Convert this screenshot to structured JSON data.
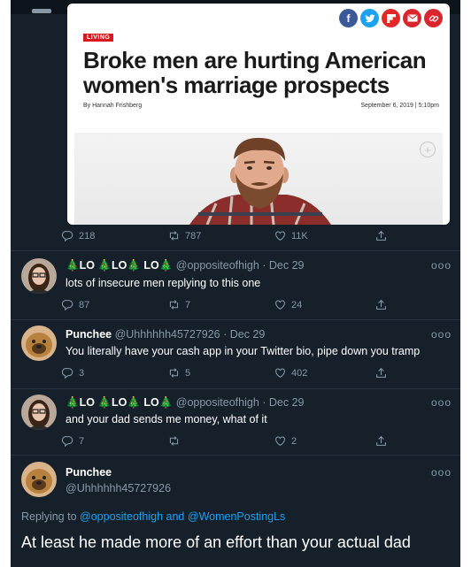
{
  "article": {
    "section": "LIVING",
    "headline": "Broke men are hurting American women's marriage prospects",
    "byline": "By Hannah Frishberg",
    "date": "September 6, 2019 | 5:10pm",
    "share_icons": [
      "facebook-icon",
      "twitter-icon",
      "flipboard-icon",
      "email-icon",
      "link-icon"
    ]
  },
  "main_tweet_stats": {
    "replies": "218",
    "retweets": "787",
    "likes": "11K"
  },
  "tweets": [
    {
      "name": "🎄LO 🎄LO🎄 LO🎄",
      "handle": "@oppositeofhigh",
      "date": "· Dec 29",
      "text": "lots of insecure men replying to this one",
      "replies": "87",
      "retweets": "7",
      "likes": "24"
    },
    {
      "name": "Punchee",
      "handle": "@Uhhhhhh45727926",
      "date": "· Dec 29",
      "text": "You literally have your cash app in your Twitter bio, pipe down you tramp",
      "replies": "3",
      "retweets": "5",
      "likes": "402"
    },
    {
      "name": "🎄LO 🎄LO🎄 LO🎄",
      "handle": "@oppositeofhigh",
      "date": "· Dec 29",
      "text": "and your dad sends me money, what of it",
      "replies": "7",
      "retweets": "",
      "likes": "2"
    }
  ],
  "final_tweet": {
    "name": "Punchee",
    "handle": "@Uhhhhhh45727926",
    "replying_prefix": "Replying to",
    "reply_to_1": "@oppositeofhigh",
    "reply_and": "and",
    "reply_to_2": "@WomenPostingLs",
    "text": "At least he made more of an effort than your actual dad"
  },
  "more_label": "ooo",
  "colors": {
    "background": "#15202b",
    "link": "#1da1f2",
    "muted": "#8899a6",
    "section_tag": "#d71920"
  }
}
